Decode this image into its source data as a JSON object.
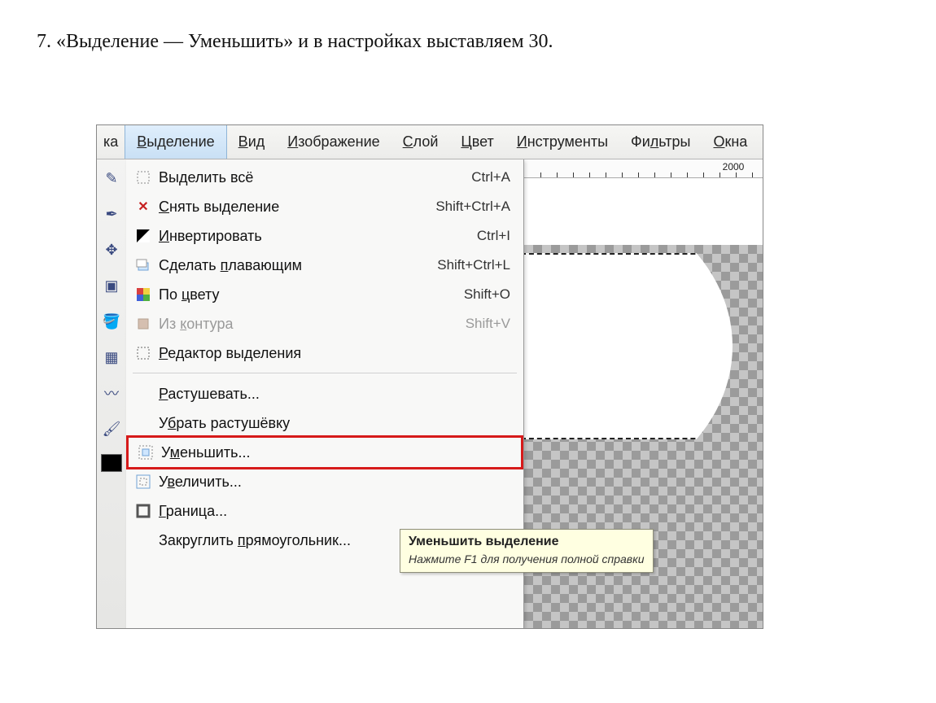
{
  "instruction": "7. «Выделение — Уменьшить» и в настройках выставляем 30.",
  "menubar": {
    "partial": "ка",
    "items": [
      {
        "label": "Выделение",
        "hotkey": "В",
        "active": true
      },
      {
        "label": "Вид",
        "hotkey": "В"
      },
      {
        "label": "Изображение",
        "hotkey": "И"
      },
      {
        "label": "Слой",
        "hotkey": "С"
      },
      {
        "label": "Цвет",
        "hotkey": "Ц"
      },
      {
        "label": "Инструменты",
        "hotkey": "И"
      },
      {
        "label": "Фильтры",
        "hotkey": "Ф"
      },
      {
        "label": "Окна",
        "hotkey": "О",
        "cut": "Окна"
      }
    ]
  },
  "dropdown": {
    "items": [
      {
        "icon": "select-all-icon",
        "label": "Выделить всё",
        "shortcut": "Ctrl+A"
      },
      {
        "icon": "close-x-icon",
        "label": "Снять выделение",
        "shortcut": "Shift+Ctrl+A",
        "underline": "С"
      },
      {
        "icon": "invert-icon",
        "label": "Инвертировать",
        "shortcut": "Ctrl+I",
        "underline": "И"
      },
      {
        "icon": "float-icon",
        "label": "Сделать плавающим",
        "shortcut": "Shift+Ctrl+L",
        "underline": "п"
      },
      {
        "icon": "by-color-icon",
        "label": "По цвету",
        "shortcut": "Shift+O",
        "underline": "ц"
      },
      {
        "icon": "from-path-icon",
        "label": "Из контура",
        "shortcut": "Shift+V",
        "underline": "к",
        "disabled": true
      },
      {
        "icon": "editor-icon",
        "label": "Редактор выделения",
        "shortcut": "",
        "underline": "Р"
      },
      {
        "sep": true
      },
      {
        "icon": "",
        "label": "Растушевать...",
        "shortcut": "",
        "underline": "Р"
      },
      {
        "icon": "",
        "label": "Убрать растушёвку",
        "shortcut": "",
        "underline": "б"
      },
      {
        "icon": "shrink-icon",
        "label": "Уменьшить...",
        "shortcut": "",
        "underline": "м",
        "highlight": true
      },
      {
        "icon": "grow-icon",
        "label": "Увеличить...",
        "shortcut": "",
        "underline": "в"
      },
      {
        "icon": "border-icon",
        "label": "Граница...",
        "shortcut": "",
        "underline": "Г"
      },
      {
        "icon": "",
        "label": "Закруглить прямоугольник...",
        "shortcut": "",
        "underline": "п"
      }
    ]
  },
  "tooltip": {
    "title": "Уменьшить выделение",
    "body": "Нажмите F1 для получения полной справки"
  },
  "ruler": {
    "mark": "2000"
  }
}
